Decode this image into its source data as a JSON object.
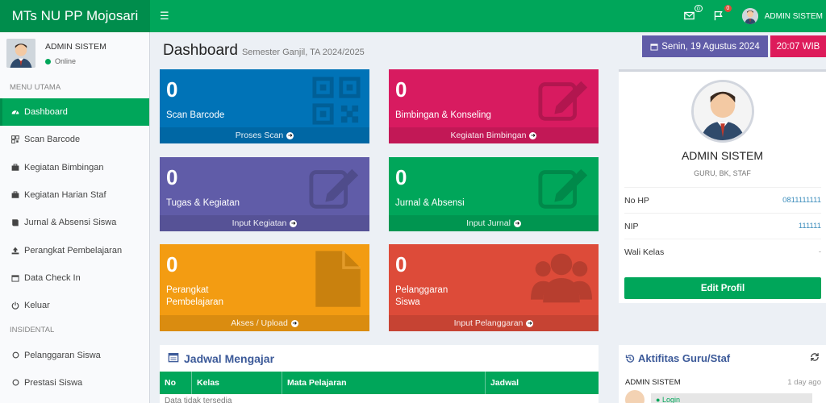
{
  "app": {
    "brand": "MTs NU PP Mojosari"
  },
  "topbar": {
    "mail_badge": "0",
    "flag_badge": "0",
    "user_name": "ADMIN SISTEM"
  },
  "sidebar": {
    "user_name": "ADMIN SISTEM",
    "status": "Online",
    "main_header": "MENU UTAMA",
    "items": [
      {
        "label": "Dashboard",
        "icon": "dashboard-icon"
      },
      {
        "label": "Scan Barcode",
        "icon": "barcode-icon"
      },
      {
        "label": "Kegiatan Bimbingan",
        "icon": "briefcase-icon"
      },
      {
        "label": "Kegiatan Harian Staf",
        "icon": "briefcase-icon"
      },
      {
        "label": "Jurnal & Absensi Siswa",
        "icon": "book-icon"
      },
      {
        "label": "Perangkat Pembelajaran",
        "icon": "upload-icon"
      },
      {
        "label": "Data Check In",
        "icon": "calendar-icon"
      },
      {
        "label": "Keluar",
        "icon": "power-icon"
      }
    ],
    "incidental_header": "INSIDENTAL",
    "incidental_items": [
      {
        "label": "Pelanggaran Siswa",
        "icon": "circle-icon"
      },
      {
        "label": "Prestasi Siswa",
        "icon": "circle-icon"
      }
    ]
  },
  "header": {
    "title": "Dashboard",
    "subtitle": "Semester Ganjil, TA 2024/2025",
    "date": "Senin, 19 Agustus 2024",
    "time": "20:07 WIB"
  },
  "tiles": [
    {
      "value": "0",
      "label": "Scan Barcode",
      "footer": "Proses Scan",
      "color": "#0073b7",
      "icon": "qrcode-icon"
    },
    {
      "value": "0",
      "label": "Bimbingan & Konseling",
      "footer": "Kegiatan Bimbingan",
      "color": "#d81b60",
      "icon": "edit-icon"
    },
    {
      "value": "0",
      "label": "Tugas & Kegiatan",
      "footer": "Input Kegiatan",
      "color": "#605ca8",
      "icon": "edit-icon"
    },
    {
      "value": "0",
      "label": "Jurnal & Absensi",
      "footer": "Input Jurnal",
      "color": "#00a65a",
      "icon": "edit-icon"
    },
    {
      "value": "0",
      "label_line1": "Perangkat",
      "label_line2": "Pembelajaran",
      "footer": "Akses / Upload",
      "color": "#f39c12",
      "icon": "file-icon"
    },
    {
      "value": "0",
      "label_line1": "Pelanggaran",
      "label_line2": "Siswa",
      "footer": "Input Pelanggaran",
      "color": "#dd4b39",
      "icon": "users-icon"
    }
  ],
  "profile": {
    "name": "ADMIN SISTEM",
    "role": "GURU, BK, STAF",
    "rows": [
      {
        "key": "No HP",
        "value": "0811111111"
      },
      {
        "key": "NIP",
        "value": "111111"
      },
      {
        "key": "Wali Kelas",
        "value": "-"
      }
    ],
    "edit_label": "Edit Profil"
  },
  "schedule": {
    "title": "Jadwal Mengajar",
    "columns": [
      "No",
      "Kelas",
      "Mata Pelajaran",
      "Jadwal"
    ],
    "empty": "Data tidak tersedia"
  },
  "activity": {
    "title": "Aktifitas Guru/Staf",
    "entries": [
      {
        "who": "ADMIN SISTEM",
        "when": "1 day ago",
        "action": "Login"
      }
    ]
  }
}
